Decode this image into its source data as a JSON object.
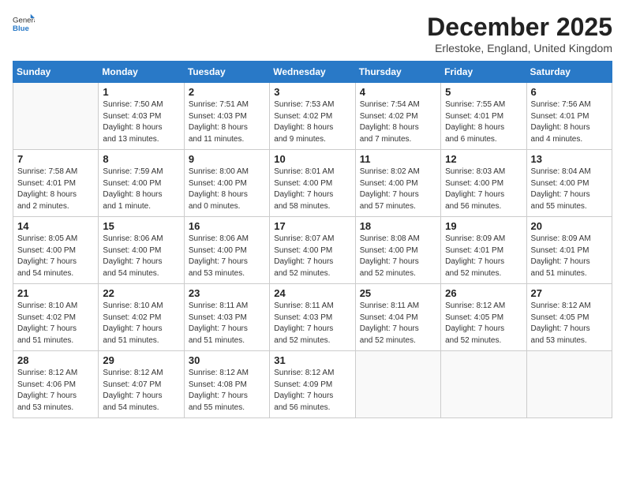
{
  "logo": {
    "general": "General",
    "blue": "Blue"
  },
  "title": "December 2025",
  "subtitle": "Erlestoke, England, United Kingdom",
  "days_of_week": [
    "Sunday",
    "Monday",
    "Tuesday",
    "Wednesday",
    "Thursday",
    "Friday",
    "Saturday"
  ],
  "weeks": [
    [
      {
        "num": "",
        "info": ""
      },
      {
        "num": "1",
        "info": "Sunrise: 7:50 AM\nSunset: 4:03 PM\nDaylight: 8 hours\nand 13 minutes."
      },
      {
        "num": "2",
        "info": "Sunrise: 7:51 AM\nSunset: 4:03 PM\nDaylight: 8 hours\nand 11 minutes."
      },
      {
        "num": "3",
        "info": "Sunrise: 7:53 AM\nSunset: 4:02 PM\nDaylight: 8 hours\nand 9 minutes."
      },
      {
        "num": "4",
        "info": "Sunrise: 7:54 AM\nSunset: 4:02 PM\nDaylight: 8 hours\nand 7 minutes."
      },
      {
        "num": "5",
        "info": "Sunrise: 7:55 AM\nSunset: 4:01 PM\nDaylight: 8 hours\nand 6 minutes."
      },
      {
        "num": "6",
        "info": "Sunrise: 7:56 AM\nSunset: 4:01 PM\nDaylight: 8 hours\nand 4 minutes."
      }
    ],
    [
      {
        "num": "7",
        "info": "Sunrise: 7:58 AM\nSunset: 4:01 PM\nDaylight: 8 hours\nand 2 minutes."
      },
      {
        "num": "8",
        "info": "Sunrise: 7:59 AM\nSunset: 4:00 PM\nDaylight: 8 hours\nand 1 minute."
      },
      {
        "num": "9",
        "info": "Sunrise: 8:00 AM\nSunset: 4:00 PM\nDaylight: 8 hours\nand 0 minutes."
      },
      {
        "num": "10",
        "info": "Sunrise: 8:01 AM\nSunset: 4:00 PM\nDaylight: 7 hours\nand 58 minutes."
      },
      {
        "num": "11",
        "info": "Sunrise: 8:02 AM\nSunset: 4:00 PM\nDaylight: 7 hours\nand 57 minutes."
      },
      {
        "num": "12",
        "info": "Sunrise: 8:03 AM\nSunset: 4:00 PM\nDaylight: 7 hours\nand 56 minutes."
      },
      {
        "num": "13",
        "info": "Sunrise: 8:04 AM\nSunset: 4:00 PM\nDaylight: 7 hours\nand 55 minutes."
      }
    ],
    [
      {
        "num": "14",
        "info": "Sunrise: 8:05 AM\nSunset: 4:00 PM\nDaylight: 7 hours\nand 54 minutes."
      },
      {
        "num": "15",
        "info": "Sunrise: 8:06 AM\nSunset: 4:00 PM\nDaylight: 7 hours\nand 54 minutes."
      },
      {
        "num": "16",
        "info": "Sunrise: 8:06 AM\nSunset: 4:00 PM\nDaylight: 7 hours\nand 53 minutes."
      },
      {
        "num": "17",
        "info": "Sunrise: 8:07 AM\nSunset: 4:00 PM\nDaylight: 7 hours\nand 52 minutes."
      },
      {
        "num": "18",
        "info": "Sunrise: 8:08 AM\nSunset: 4:00 PM\nDaylight: 7 hours\nand 52 minutes."
      },
      {
        "num": "19",
        "info": "Sunrise: 8:09 AM\nSunset: 4:01 PM\nDaylight: 7 hours\nand 52 minutes."
      },
      {
        "num": "20",
        "info": "Sunrise: 8:09 AM\nSunset: 4:01 PM\nDaylight: 7 hours\nand 51 minutes."
      }
    ],
    [
      {
        "num": "21",
        "info": "Sunrise: 8:10 AM\nSunset: 4:02 PM\nDaylight: 7 hours\nand 51 minutes."
      },
      {
        "num": "22",
        "info": "Sunrise: 8:10 AM\nSunset: 4:02 PM\nDaylight: 7 hours\nand 51 minutes."
      },
      {
        "num": "23",
        "info": "Sunrise: 8:11 AM\nSunset: 4:03 PM\nDaylight: 7 hours\nand 51 minutes."
      },
      {
        "num": "24",
        "info": "Sunrise: 8:11 AM\nSunset: 4:03 PM\nDaylight: 7 hours\nand 52 minutes."
      },
      {
        "num": "25",
        "info": "Sunrise: 8:11 AM\nSunset: 4:04 PM\nDaylight: 7 hours\nand 52 minutes."
      },
      {
        "num": "26",
        "info": "Sunrise: 8:12 AM\nSunset: 4:05 PM\nDaylight: 7 hours\nand 52 minutes."
      },
      {
        "num": "27",
        "info": "Sunrise: 8:12 AM\nSunset: 4:05 PM\nDaylight: 7 hours\nand 53 minutes."
      }
    ],
    [
      {
        "num": "28",
        "info": "Sunrise: 8:12 AM\nSunset: 4:06 PM\nDaylight: 7 hours\nand 53 minutes."
      },
      {
        "num": "29",
        "info": "Sunrise: 8:12 AM\nSunset: 4:07 PM\nDaylight: 7 hours\nand 54 minutes."
      },
      {
        "num": "30",
        "info": "Sunrise: 8:12 AM\nSunset: 4:08 PM\nDaylight: 7 hours\nand 55 minutes."
      },
      {
        "num": "31",
        "info": "Sunrise: 8:12 AM\nSunset: 4:09 PM\nDaylight: 7 hours\nand 56 minutes."
      },
      {
        "num": "",
        "info": ""
      },
      {
        "num": "",
        "info": ""
      },
      {
        "num": "",
        "info": ""
      }
    ]
  ]
}
